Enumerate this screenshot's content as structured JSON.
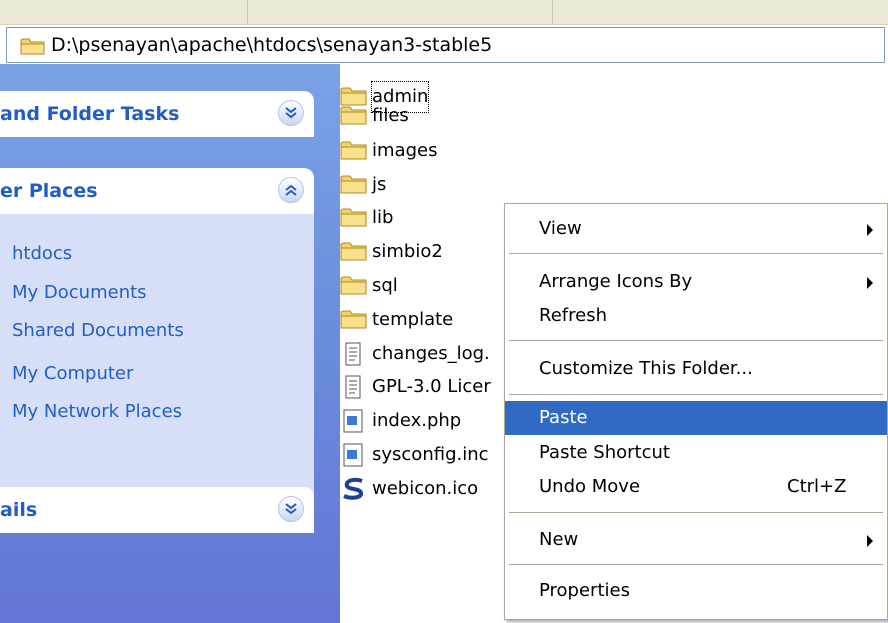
{
  "address_bar": {
    "path": "D:\\psenayan\\apache\\htdocs\\senayan3-stable5"
  },
  "sidebar": {
    "file_folder_tasks": {
      "title": "and Folder Tasks"
    },
    "other_places": {
      "title": "er Places",
      "links": [
        "htdocs",
        "My Documents",
        "Shared Documents",
        "My Computer",
        "My Network Places"
      ]
    },
    "details": {
      "title": "ails"
    }
  },
  "files": [
    {
      "name": "admin",
      "type": "folder"
    },
    {
      "name": "files",
      "type": "folder"
    },
    {
      "name": "images",
      "type": "folder"
    },
    {
      "name": "js",
      "type": "folder"
    },
    {
      "name": "lib",
      "type": "folder"
    },
    {
      "name": "simbio2",
      "type": "folder"
    },
    {
      "name": "sql",
      "type": "folder"
    },
    {
      "name": "template",
      "type": "folder"
    },
    {
      "name": "changes_log.",
      "type": "text"
    },
    {
      "name": "GPL-3.0 Licer",
      "type": "text"
    },
    {
      "name": "index.php",
      "type": "php"
    },
    {
      "name": "sysconfig.inc",
      "type": "php"
    },
    {
      "name": "webicon.ico",
      "type": "ico"
    }
  ],
  "context_menu": {
    "view": "View",
    "arrange_icons_by": "Arrange Icons By",
    "refresh": "Refresh",
    "customize": "Customize This Folder...",
    "paste": "Paste",
    "paste_shortcut": "Paste Shortcut",
    "undo_move": "Undo Move",
    "undo_shortcut": "Ctrl+Z",
    "new": "New",
    "properties": "Properties"
  },
  "colors": {
    "task_title": "#215dc6",
    "panel_blue": "#6b8fdb",
    "menu_highlight": "#316ac5",
    "folder_yellow": "#f4d26b"
  }
}
